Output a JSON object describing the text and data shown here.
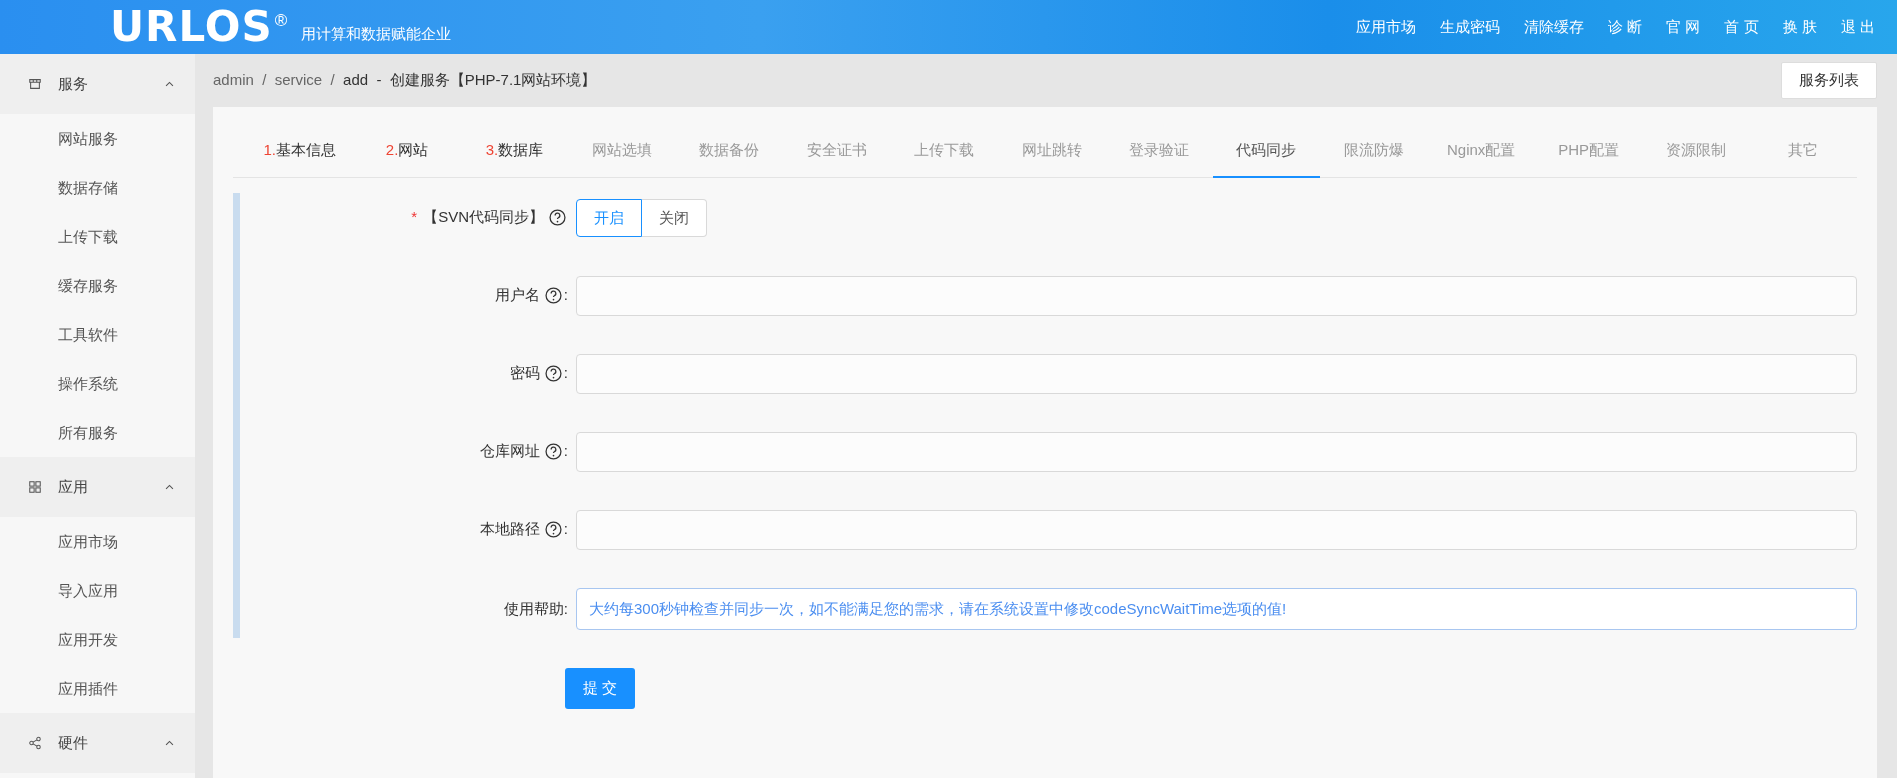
{
  "header": {
    "logo": "URLOS",
    "logo_mark": "®",
    "slogan": "用计算和数据赋能企业",
    "links": [
      "应用市场",
      "生成密码",
      "清除缓存",
      "诊 断",
      "官 网",
      "首 页",
      "换 肤",
      "退 出"
    ]
  },
  "sidebar": {
    "groups": [
      {
        "label": "服务",
        "expanded": true,
        "items": [
          "网站服务",
          "数据存储",
          "上传下载",
          "缓存服务",
          "工具软件",
          "操作系统",
          "所有服务"
        ]
      },
      {
        "label": "应用",
        "expanded": true,
        "items": [
          "应用市场",
          "导入应用",
          "应用开发",
          "应用插件"
        ]
      },
      {
        "label": "硬件",
        "expanded": true
      }
    ]
  },
  "breadcrumb": {
    "parts": [
      "admin",
      "service",
      "add"
    ],
    "separator": "/",
    "dash": "-",
    "title": "创建服务【PHP-7.1网站环境】"
  },
  "list_button": "服务列表",
  "tabs": [
    {
      "number": "1.",
      "label": "基本信息",
      "selected": false
    },
    {
      "number": "2.",
      "label": "网站",
      "selected": false
    },
    {
      "number": "3.",
      "label": "数据库",
      "selected": false
    },
    {
      "label": "网站选填",
      "selected": false
    },
    {
      "label": "数据备份",
      "selected": false
    },
    {
      "label": "安全证书",
      "selected": false
    },
    {
      "label": "上传下载",
      "selected": false
    },
    {
      "label": "网址跳转",
      "selected": false
    },
    {
      "label": "登录验证",
      "selected": false
    },
    {
      "label": "代码同步",
      "selected": true
    },
    {
      "label": "限流防爆",
      "selected": false
    },
    {
      "label": "Nginx配置",
      "selected": false
    },
    {
      "label": "PHP配置",
      "selected": false
    },
    {
      "label": "资源限制",
      "selected": false
    },
    {
      "label": "其它",
      "selected": false
    }
  ],
  "form": [
    {
      "kind": "toggle",
      "required_mark": "*",
      "label": "【SVN代码同步】",
      "help_icon": true,
      "options": [
        {
          "label": "开启",
          "selected": true
        },
        {
          "label": "关闭",
          "selected": false
        }
      ]
    },
    {
      "kind": "input",
      "label": "用户名",
      "help_icon": true,
      "suffix": ":"
    },
    {
      "kind": "input",
      "label": "密码",
      "help_icon": true,
      "suffix": ":"
    },
    {
      "kind": "input",
      "label": "仓库网址",
      "help_icon": true,
      "suffix": ":"
    },
    {
      "kind": "input",
      "label": "本地路径",
      "help_icon": true,
      "suffix": ":"
    },
    {
      "kind": "note",
      "label": "使用帮助",
      "help_icon": false,
      "suffix": ":",
      "text": "大约每300秒钟检查并同步一次，如不能满足您的需求，请在系统设置中修改codeSyncWaitTime选项的值!"
    }
  ],
  "submit": "提 交"
}
